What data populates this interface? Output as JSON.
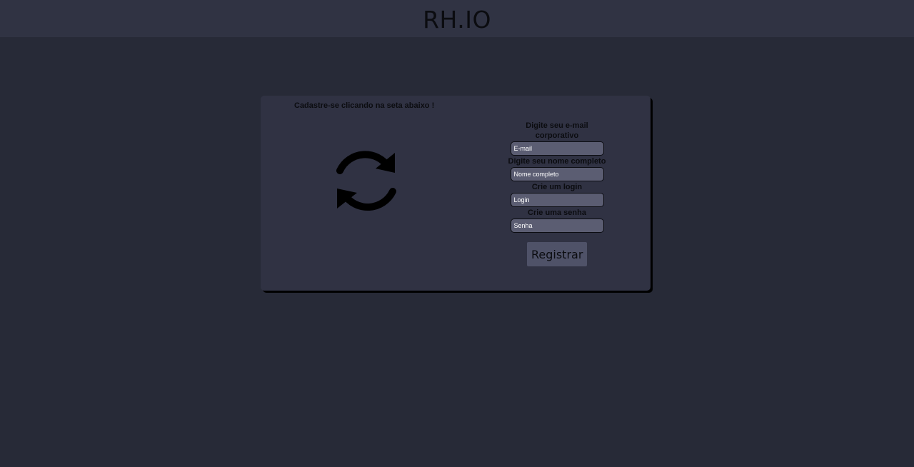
{
  "header": {
    "brand": "RH.IO"
  },
  "promo": {
    "text": "Cadastre-se clicando na seta abaixo !",
    "icon": "refresh-icon"
  },
  "form": {
    "email": {
      "label": "Digite seu e-mail corporativo",
      "placeholder": "E-mail",
      "value": ""
    },
    "name": {
      "label": "Digite seu nome completo",
      "placeholder": "Nome completo",
      "value": ""
    },
    "login": {
      "label": "Crie um login",
      "placeholder": "Login",
      "value": ""
    },
    "password": {
      "label": "Crie uma senha",
      "placeholder": "Senha",
      "value": ""
    },
    "submit_label": "Registrar"
  },
  "colors": {
    "background": "#272a37",
    "topbar": "#303343",
    "card": "#303243",
    "input": "#5b5d72",
    "button": "#4f5268",
    "text": "#0b0c10"
  }
}
